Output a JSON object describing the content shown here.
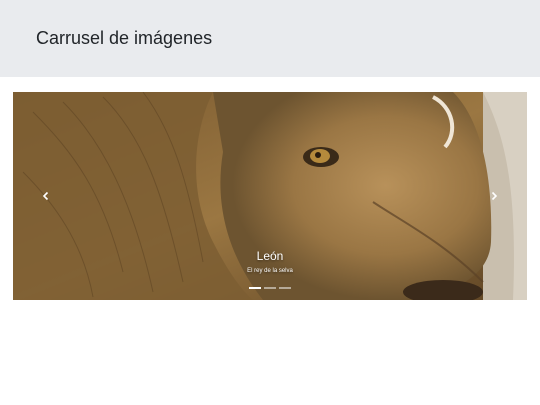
{
  "header": {
    "title": "Carrusel de imágenes"
  },
  "carousel": {
    "slides": [
      {
        "title": "León",
        "text": "El rey de la selva",
        "image": "lion-face-closeup"
      }
    ],
    "indicator_count": 3,
    "active_index": 0,
    "prev_icon": "chevron-left-icon",
    "next_icon": "chevron-right-icon"
  },
  "colors": {
    "header_bg": "#e9ebee",
    "caption_text": "#ffffff",
    "mane": "#8a6a3c"
  }
}
